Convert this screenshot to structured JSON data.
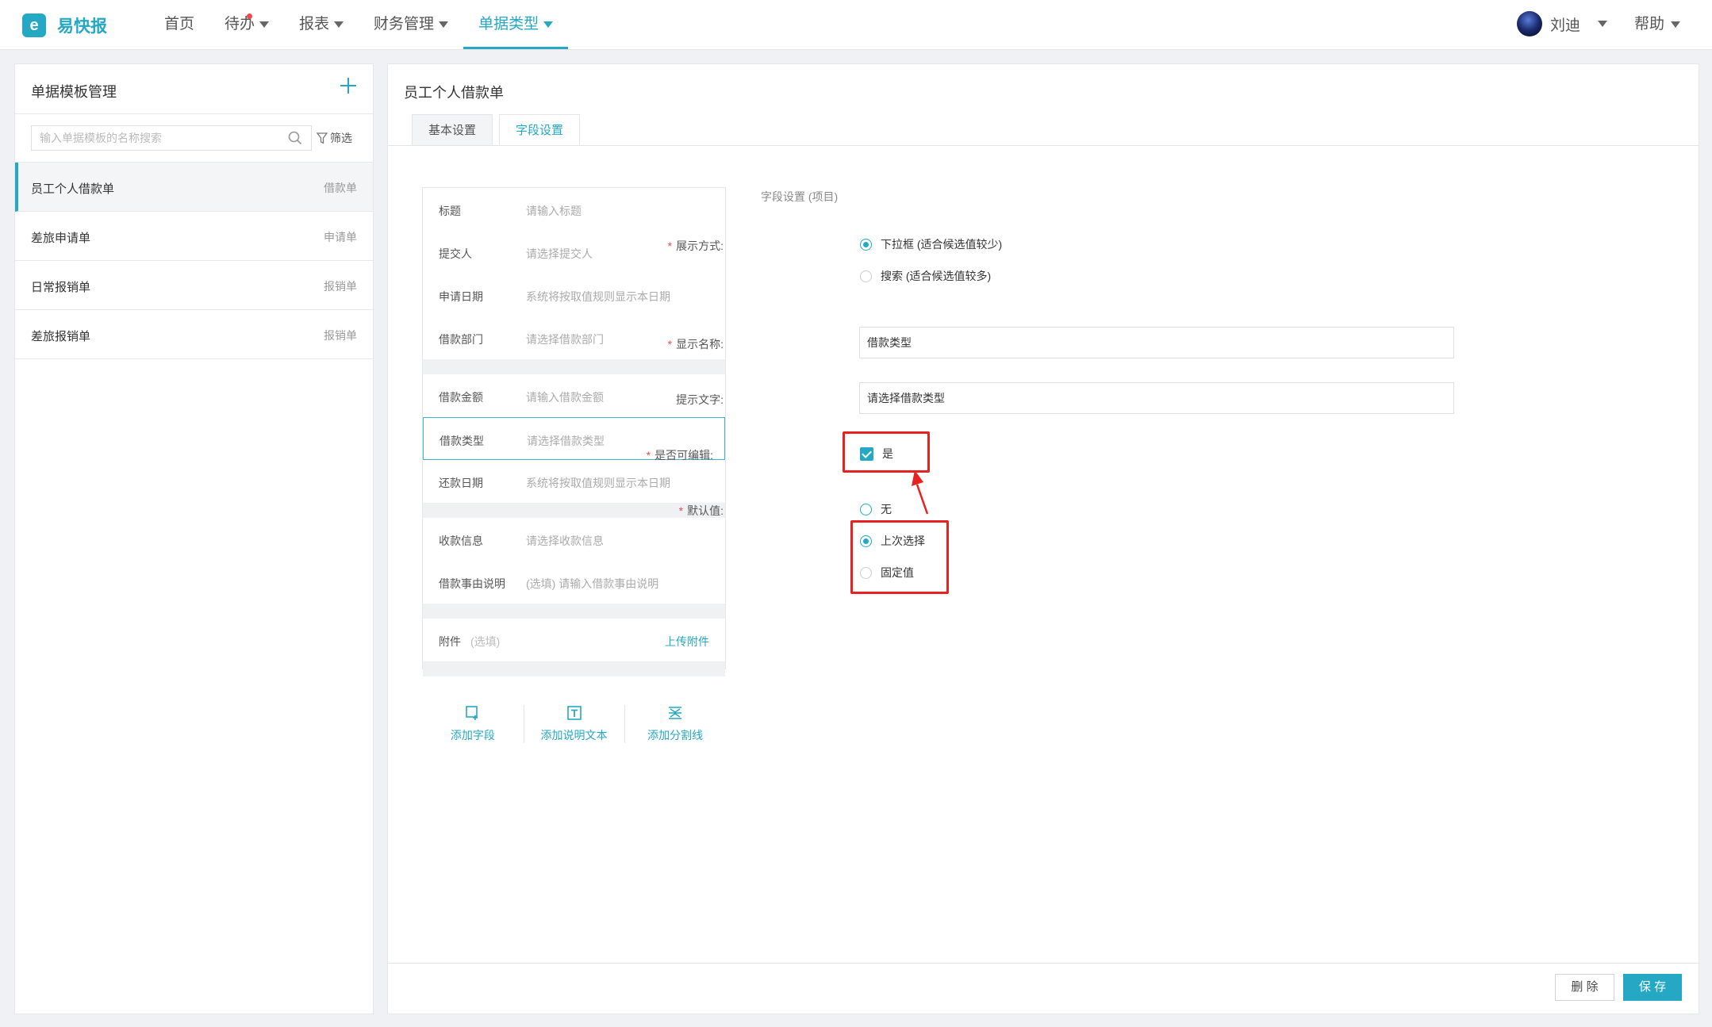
{
  "app": {
    "name": "易快报",
    "logo_glyph": "e"
  },
  "nav": {
    "items": [
      {
        "label": "首页",
        "has_caret": false,
        "dot": false,
        "active": false
      },
      {
        "label": "待办",
        "has_caret": true,
        "dot": true,
        "active": false
      },
      {
        "label": "报表",
        "has_caret": true,
        "dot": false,
        "active": false
      },
      {
        "label": "财务管理",
        "has_caret": true,
        "dot": false,
        "active": false
      },
      {
        "label": "单据类型",
        "has_caret": true,
        "dot": false,
        "active": true
      }
    ]
  },
  "user": {
    "name": "刘迪"
  },
  "help": {
    "label": "帮助"
  },
  "left_panel": {
    "title": "单据模板管理",
    "add_icon": "plus-icon",
    "search_placeholder": "输入单据模板的名称搜索",
    "filter_label": "筛选",
    "templates": [
      {
        "name": "员工个人借款单",
        "type": "借款单",
        "active": true
      },
      {
        "name": "差旅申请单",
        "type": "申请单",
        "active": false
      },
      {
        "name": "日常报销单",
        "type": "报销单",
        "active": false
      },
      {
        "name": "差旅报销单",
        "type": "报销单",
        "active": false
      }
    ]
  },
  "main": {
    "title": "员工个人借款单",
    "tabs": [
      {
        "label": "基本设置",
        "active": false
      },
      {
        "label": "字段设置",
        "active": true
      }
    ],
    "fields": {
      "group1": [
        {
          "label": "标题",
          "hint": "请输入标题"
        },
        {
          "label": "提交人",
          "hint": "请选择提交人"
        },
        {
          "label": "申请日期",
          "hint": "系统将按取值规则显示本日期"
        },
        {
          "label": "借款部门",
          "hint": "请选择借款部门"
        }
      ],
      "group2": [
        {
          "label": "借款金额",
          "hint": "请输入借款金额"
        },
        {
          "label": "借款类型",
          "hint": "请选择借款类型",
          "selected": true
        },
        {
          "label": "还款日期",
          "hint": "系统将按取值规则显示本日期"
        }
      ],
      "group3": [
        {
          "label": "收款信息",
          "hint": "请选择收款信息"
        },
        {
          "label": "借款事由说明",
          "hint": "(选填) 请输入借款事由说明"
        }
      ],
      "attachment": {
        "label": "附件",
        "optional": "(选填)",
        "upload_label": "上传附件"
      }
    },
    "add_actions": [
      {
        "label": "添加字段",
        "icon": "add-field-icon"
      },
      {
        "label": "添加说明文本",
        "icon": "text-box-icon"
      },
      {
        "label": "添加分割线",
        "icon": "divider-icon"
      }
    ],
    "settings": {
      "title": "字段设置 (项目)",
      "display_mode": {
        "label": "展示方式:",
        "options": [
          "下拉框 (适合候选值较少)",
          "搜索 (适合候选值较多)"
        ],
        "selected": 0
      },
      "display_name": {
        "label": "显示名称:",
        "value": "借款类型"
      },
      "hint_text": {
        "label": "提示文字:",
        "value": "请选择借款类型"
      },
      "editable": {
        "label": "是否可编辑:",
        "option": "是",
        "checked": true
      },
      "default_value": {
        "label": "默认值:",
        "options": [
          "无",
          "上次选择",
          "固定值"
        ],
        "selected": 1
      },
      "required_mark": "*"
    },
    "buttons": {
      "delete": "删 除",
      "save": "保 存"
    }
  },
  "colors": {
    "accent": "#24a8c3",
    "annotation": "#e82121",
    "required": "#f04a4a"
  }
}
